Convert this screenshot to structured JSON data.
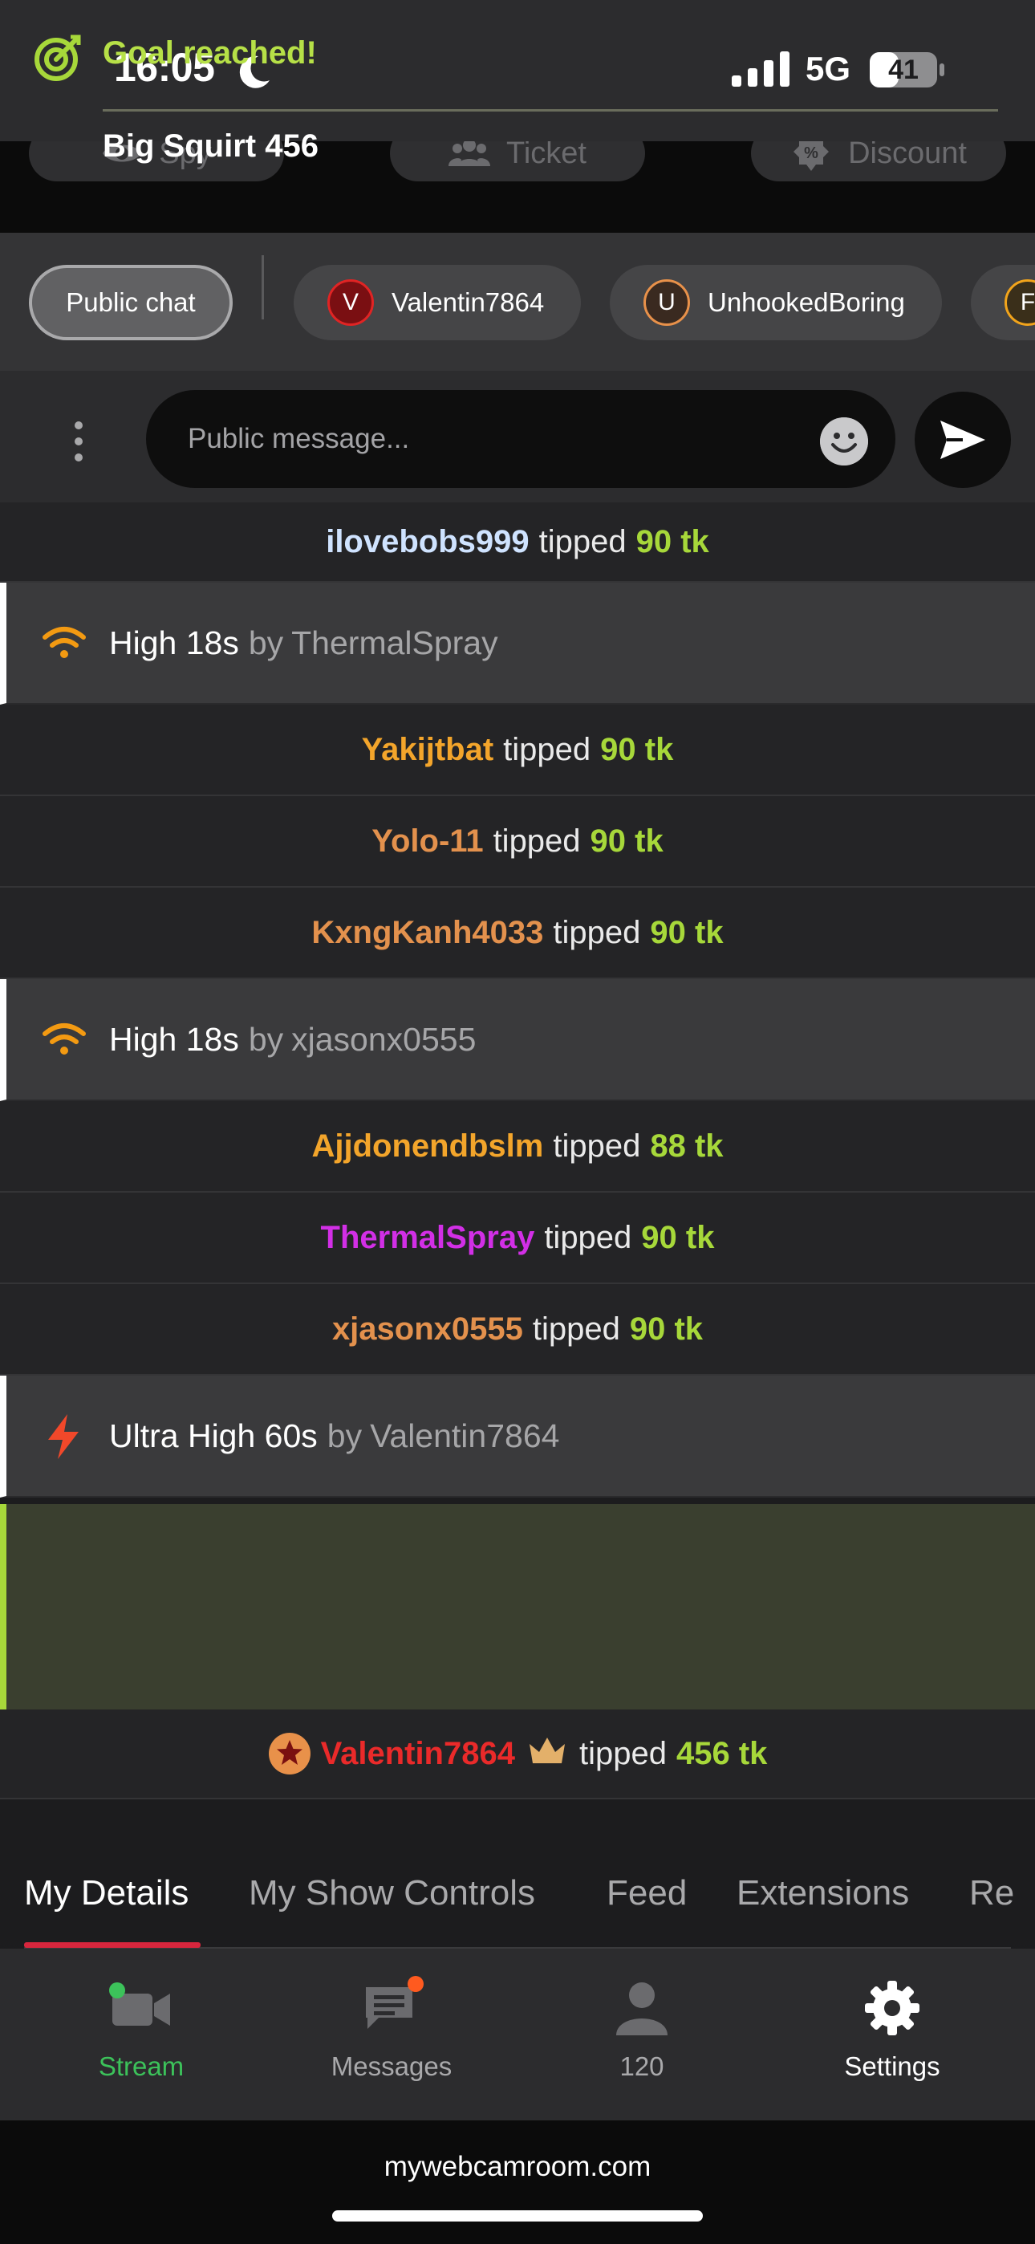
{
  "status_bar": {
    "time": "16:05",
    "network": "5G",
    "battery": "41"
  },
  "actions": [
    {
      "label": "Spy",
      "icon": "eye-icon"
    },
    {
      "label": "Ticket",
      "icon": "users-icon"
    },
    {
      "label": "Discount",
      "icon": "discount-icon"
    }
  ],
  "chat_tabs": {
    "public": "Public chat",
    "users": [
      {
        "name": "Valentin7864",
        "initial": "V",
        "ring": "#e02424",
        "bg": "#7a0f12"
      },
      {
        "name": "UnhookedBoring",
        "initial": "U",
        "ring": "#e8914a",
        "bg": "#3a2a20"
      },
      {
        "name": "",
        "initial": "F",
        "ring": "#f2a41b",
        "bg": "#3a2f1a"
      }
    ]
  },
  "input": {
    "placeholder": "Public message..."
  },
  "feed": {
    "tip_word": "tipped",
    "rows": [
      {
        "kind": "tip",
        "user": "ilovebobs999",
        "color": "#cfe3ff",
        "amount": "90 tk"
      },
      {
        "kind": "show",
        "title": "High 18s",
        "by_word": "by",
        "by": "ThermalSpray",
        "icon": "wifi-icon"
      },
      {
        "kind": "tip",
        "user": "Yakijtbat",
        "color": "#f3a52b",
        "amount": "90 tk"
      },
      {
        "kind": "tip",
        "user": "Yolo-11",
        "color": "#e3914d",
        "amount": "90 tk"
      },
      {
        "kind": "tip",
        "user": "KxngKanh4033",
        "color": "#e3914d",
        "amount": "90 tk"
      },
      {
        "kind": "show",
        "title": "High 18s",
        "by_word": "by",
        "by": "xjasonx0555",
        "icon": "wifi-icon"
      },
      {
        "kind": "tip",
        "user": "Ajjdonendbslm",
        "color": "#f3a52b",
        "amount": "88 tk"
      },
      {
        "kind": "tip",
        "user": "ThermalSpray",
        "color": "#d22fe6",
        "amount": "90 tk"
      },
      {
        "kind": "tip",
        "user": "xjasonx0555",
        "color": "#e3914d",
        "amount": "90 tk"
      },
      {
        "kind": "show",
        "title": "Ultra High 60s",
        "by_word": "by",
        "by": "Valentin7864",
        "icon": "lightning-icon"
      }
    ],
    "goal": {
      "title": "Goal reached!",
      "name": "Big Squirt 456"
    },
    "last_tip": {
      "user": "Valentin7864",
      "color": "#ea2a2a",
      "amount": "456 tk"
    }
  },
  "detail_tabs": [
    "My Details",
    "My Show Controls",
    "Feed",
    "Extensions",
    "Re"
  ],
  "nav": [
    {
      "label": "Stream",
      "color": "#3cc25a",
      "icon": "video-camera-icon"
    },
    {
      "label": "Messages",
      "color": "#a9a9ab",
      "icon": "message-icon"
    },
    {
      "label": "120",
      "color": "#a9a9ab",
      "icon": "user-icon"
    },
    {
      "label": "Settings",
      "color": "#ffffff",
      "icon": "gear-icon"
    }
  ],
  "url": "mywebcamroom.com",
  "colors": {
    "accent_green": "#a7d83a",
    "accent_red": "#d7263d",
    "wifi_orange": "#f39a12",
    "lightning": "#f1482a"
  }
}
